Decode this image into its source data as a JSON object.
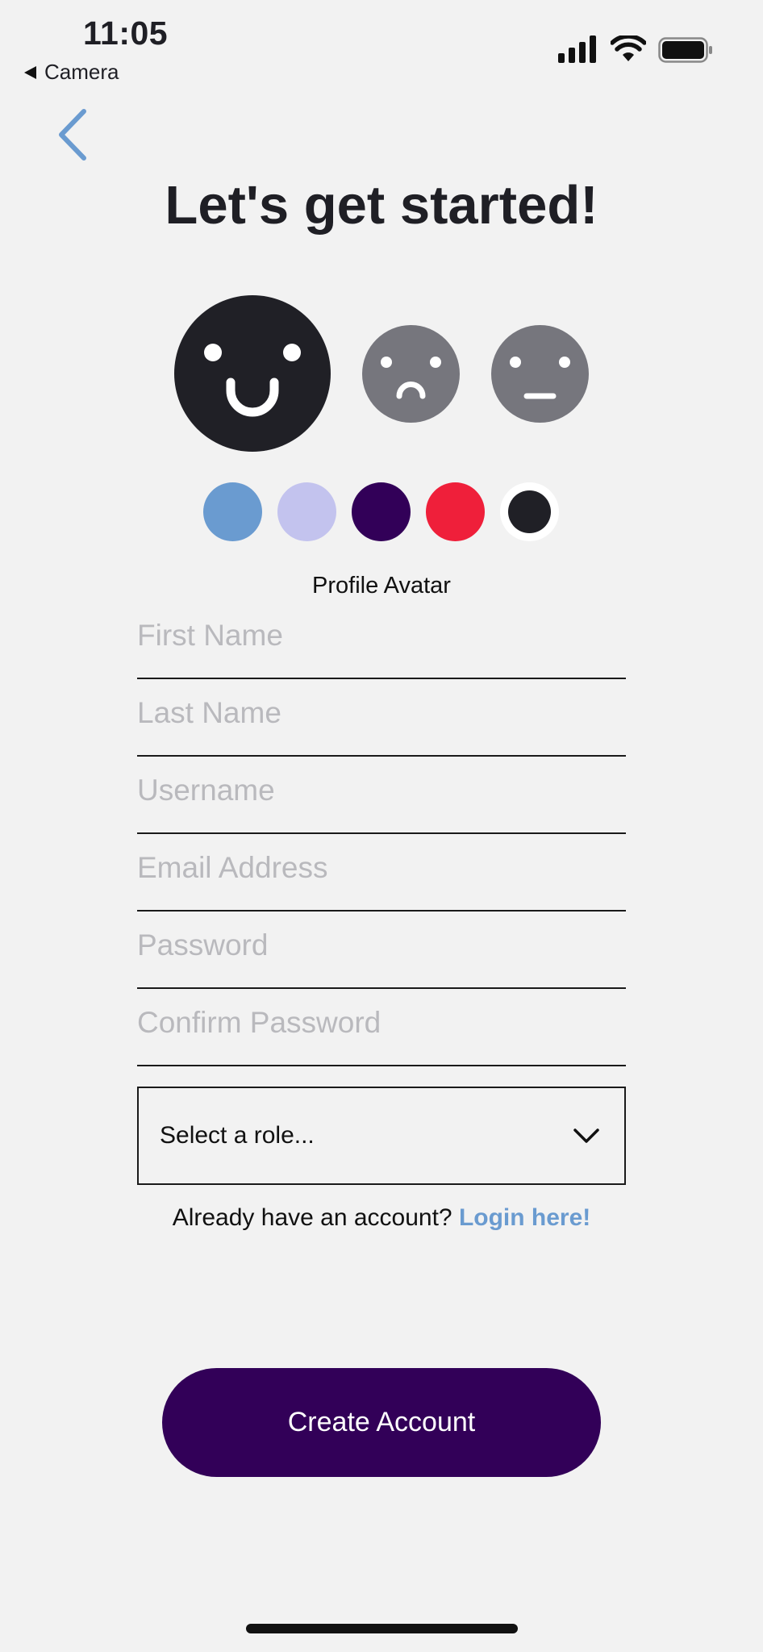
{
  "status_bar": {
    "time": "11:05",
    "back_app": "Camera"
  },
  "icons": {
    "back": "chevron-left-icon",
    "signal": "cellular-signal-icon",
    "wifi": "wifi-icon",
    "battery": "battery-icon",
    "dropdown": "chevron-down-icon"
  },
  "title": "Let's get started!",
  "avatars": {
    "faces": [
      "happy-face",
      "sad-face",
      "neutral-face"
    ],
    "selected_face": "happy-face",
    "colors": [
      "#6a9bd0",
      "#c3c3ee",
      "#320058",
      "#ef1f3a",
      "#202026"
    ],
    "selected_color": "#202026",
    "label": "Profile Avatar"
  },
  "form": {
    "first_name_placeholder": "First Name",
    "last_name_placeholder": "Last Name",
    "username_placeholder": "Username",
    "email_placeholder": "Email Address",
    "password_placeholder": "Password",
    "confirm_password_placeholder": "Confirm Password",
    "role_select": "Select a role..."
  },
  "login": {
    "prompt": "Already have an account?",
    "link": "Login here!"
  },
  "create_button": "Create Account",
  "theme": {
    "background": "#f2f2f2",
    "accent": "#6a9bd0",
    "primary": "#320058"
  }
}
